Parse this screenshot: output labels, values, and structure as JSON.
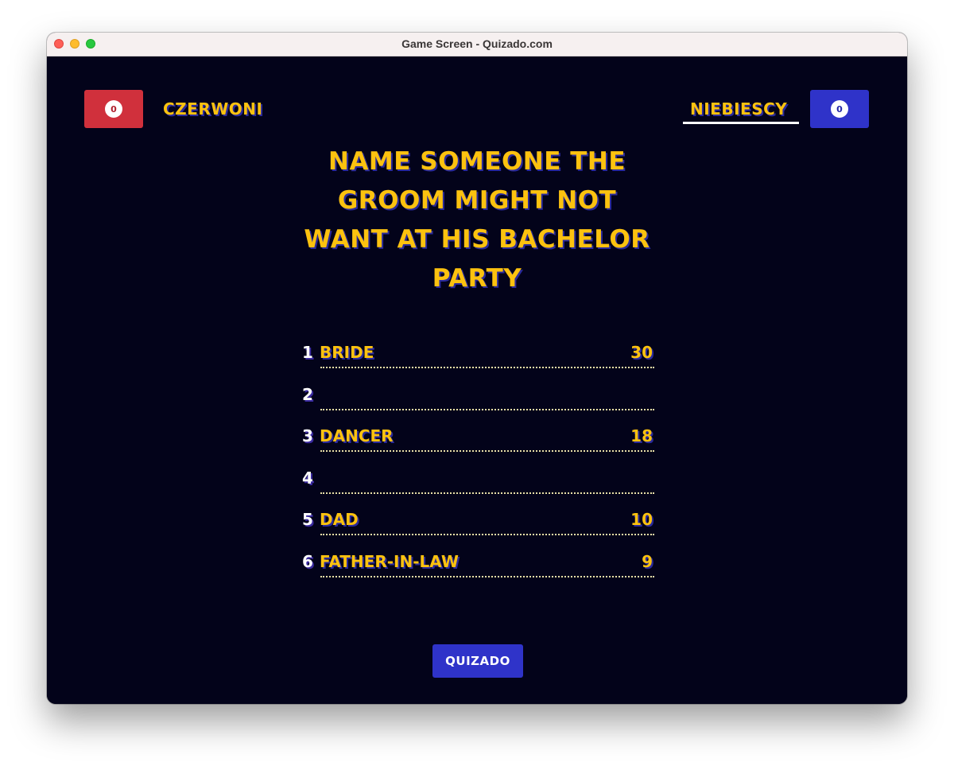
{
  "window": {
    "title": "Game Screen - Quizado.com"
  },
  "teams": {
    "left": {
      "name": "CZERWONI",
      "score": "0",
      "color": "#d0303c"
    },
    "right": {
      "name": "NIEBIESCY",
      "score": "0",
      "color": "#2f33c9",
      "active": true
    }
  },
  "question": "NAME SOMEONE THE GROOM MIGHT NOT WANT AT HIS BACHELOR PARTY",
  "answers": [
    {
      "number": "1",
      "text": "BRIDE",
      "points": "30"
    },
    {
      "number": "2",
      "text": "",
      "points": ""
    },
    {
      "number": "3",
      "text": "DANCER",
      "points": "18"
    },
    {
      "number": "4",
      "text": "",
      "points": ""
    },
    {
      "number": "5",
      "text": "DAD",
      "points": "10"
    },
    {
      "number": "6",
      "text": "FATHER-IN-LAW",
      "points": "9"
    }
  ],
  "logo": {
    "text": "QUIZADO"
  },
  "colors": {
    "background": "#03031a",
    "accent": "#fcc20f",
    "text_shadow": "#2a2a9c"
  }
}
